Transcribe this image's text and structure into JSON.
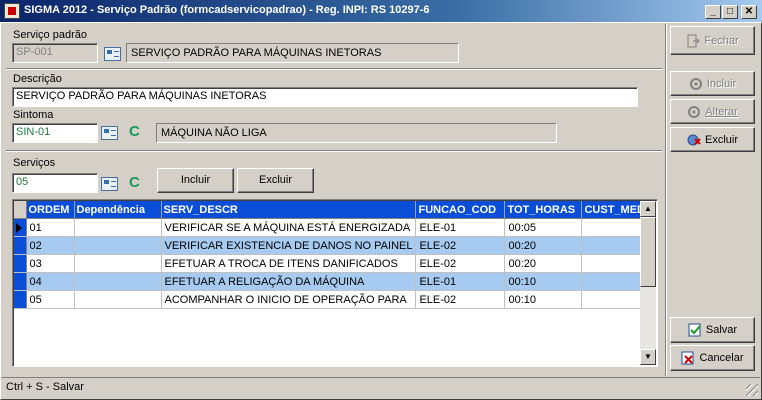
{
  "window": {
    "title": "SIGMA 2012 - Serviço Padrão  (formcadservicopadrao) - Reg. INPI: RS 10297-6",
    "min_glyph": "_",
    "max_glyph": "□",
    "close_glyph": "✕"
  },
  "servico_padrao": {
    "label": "Serviço padrão",
    "code": "SP-001",
    "description": "SERVIÇO PADRÃO PARA MÁQUINAS INETORAS"
  },
  "descricao": {
    "label": "Descrição",
    "value": "SERVIÇO PADRÃO PARA MÁQUINAS INETORAS"
  },
  "sintoma": {
    "label": "Sintoma",
    "code": "SIN-01",
    "c_label": "C",
    "description": "MÁQUINA NÃO LIGA"
  },
  "servicos": {
    "label": "Serviços",
    "code": "05",
    "c_label": "C",
    "incluir_label": "Incluir",
    "excluir_label": "Excluir"
  },
  "grid": {
    "columns": [
      "ORDEM",
      "Dependência",
      "SERV_DESCR",
      "FUNCAO_COD",
      "TOT_HORAS",
      "CUST_MED"
    ],
    "rows": [
      [
        "01",
        "",
        "VERIFICAR SE A MÁQUINA ESTÁ ENERGIZADA",
        "ELE-01",
        "00:05",
        ""
      ],
      [
        "02",
        "",
        "VERIFICAR EXISTENCIA DE DANOS NO PAINEL",
        "ELE-02",
        "00:20",
        ""
      ],
      [
        "03",
        "",
        "EFETUAR A TROCA DE ITENS DANIFICADOS",
        "ELE-02",
        "00:20",
        ""
      ],
      [
        "04",
        "",
        "EFETUAR A RELIGAÇÃO DA MÁQUINA",
        "ELE-01",
        "00:10",
        ""
      ],
      [
        "05",
        "",
        "ACOMPANHAR O INICIO DE OPERAÇÃO PARA",
        "ELE-02",
        "00:10",
        ""
      ]
    ],
    "up_glyph": "▲",
    "down_glyph": "▼"
  },
  "sidebar": {
    "fechar": "Fechar",
    "incluir": "Incluir",
    "alterar": "Alterar",
    "excluir": "Excluir",
    "salvar": "Salvar",
    "cancelar": "Cancelar"
  },
  "status": {
    "hint": "Ctrl + S - Salvar"
  },
  "colors": {
    "title_start": "#0a246a",
    "header_blue": "#0a4ed8",
    "row_highlight": "#a6caf0",
    "green_value": "#1a7a3a"
  }
}
